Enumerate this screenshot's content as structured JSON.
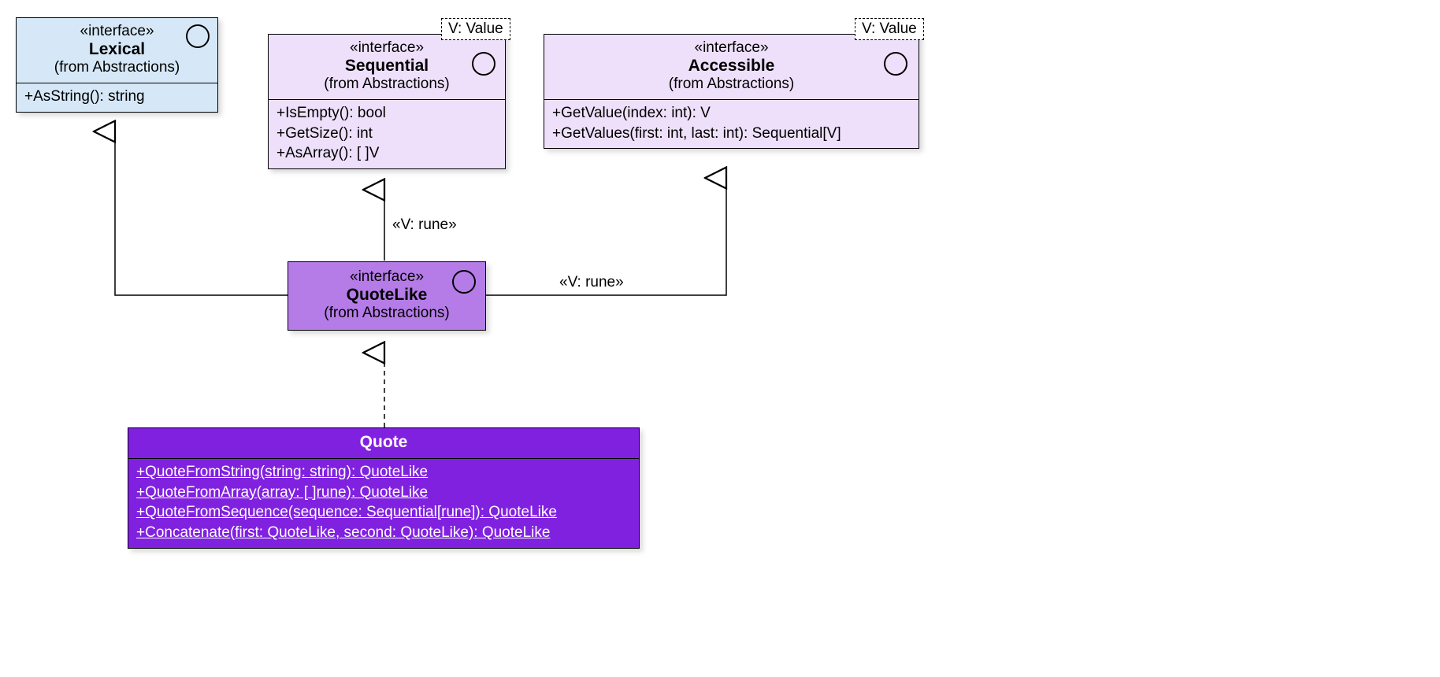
{
  "colors": {
    "lexical_bg": "#d6e8f7",
    "sequential_bg": "#eee0fa",
    "accessible_bg": "#eee0fa",
    "quotelike_bg": "#b57ce8",
    "quote_head_bg": "#8121e0",
    "quote_body_bg": "#8121e0"
  },
  "lexical": {
    "stereo": "interface",
    "name": "Lexical",
    "pkg": "(from Abstractions)",
    "methods": [
      "+AsString(): string"
    ]
  },
  "sequential": {
    "stereo": "interface",
    "name": "Sequential",
    "pkg": "(from Abstractions)",
    "template": "V: Value",
    "methods": [
      "+IsEmpty(): bool",
      "+GetSize(): int",
      "+AsArray(): [ ]V"
    ]
  },
  "accessible": {
    "stereo": "interface",
    "name": "Accessible",
    "pkg": "(from Abstractions)",
    "template": "V: Value",
    "methods": [
      "+GetValue(index: int): V",
      "+GetValues(first: int, last: int): Sequential[V]"
    ]
  },
  "quotelike": {
    "stereo": "interface",
    "name": "QuoteLike",
    "pkg": "(from Abstractions)"
  },
  "quote": {
    "name": "Quote",
    "methods": [
      "+QuoteFromString(string: string): QuoteLike",
      "+QuoteFromArray(array: [ ]rune): QuoteLike",
      "+QuoteFromSequence(sequence: Sequential[rune]): QuoteLike",
      "+Concatenate(first: QuoteLike, second: QuoteLike): QuoteLike"
    ]
  },
  "edges": {
    "seq_label": "«V: rune»",
    "acc_label": "«V: rune»"
  }
}
